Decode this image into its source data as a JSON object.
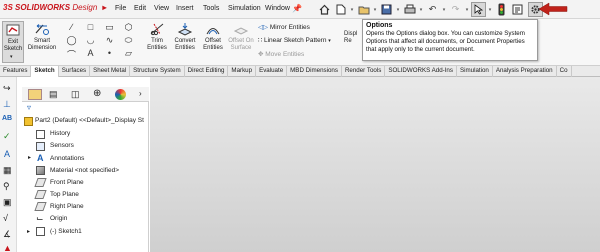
{
  "app": {
    "logo_ds": "3S",
    "logo_brand": "SOLIDWORKS",
    "logo_edition": "Design"
  },
  "menus": [
    "File",
    "Edit",
    "View",
    "Insert",
    "Tools",
    "Simulation",
    "Window"
  ],
  "quick_access": {
    "icons": [
      "home-icon",
      "new-document-icon",
      "open-icon",
      "save-icon",
      "print-icon",
      "undo-icon",
      "redo-icon",
      "select-icon",
      "traffic-light-icon",
      "file-properties-icon",
      "options-gear-icon"
    ]
  },
  "ribbon": {
    "exit_sketch": "Exit Sketch",
    "smart_dimension": "Smart Dimension",
    "trim_entities": "Trim Entities",
    "convert_entities": "Convert Entities",
    "offset_entities": "Offset Entities",
    "offset_on_surface": "Offset On Surface",
    "mirror_entities": "Mirror Entities",
    "linear_sketch_pattern": "Linear Sketch Pattern",
    "move_entities": "Move Entities",
    "display_relations": "Displ Re"
  },
  "tooltip": {
    "title": "Options",
    "body": "Opens the Options dialog box. You can customize System Options that affect all documents, or Document Properties that apply only to the current document."
  },
  "command_tabs": [
    "Features",
    "Sketch",
    "Surfaces",
    "Sheet Metal",
    "Structure System",
    "Direct Editing",
    "Markup",
    "Evaluate",
    "MBD Dimensions",
    "Render Tools",
    "SOLIDWORKS Add-Ins",
    "Simulation",
    "Analysis Preparation",
    "Co"
  ],
  "active_tab": "Sketch",
  "feature_tree": {
    "root": "Part2 (Default) <<Default>_Display St",
    "items": [
      "History",
      "Sensors",
      "Annotations",
      "Material <not specified>",
      "Front Plane",
      "Top Plane",
      "Right Plane",
      "Origin",
      "(-) Sketch1"
    ]
  },
  "colors": {
    "brand_red": "#c8141b",
    "arrow_red": "#c0221a",
    "tab_bg": "#eaeaea"
  }
}
